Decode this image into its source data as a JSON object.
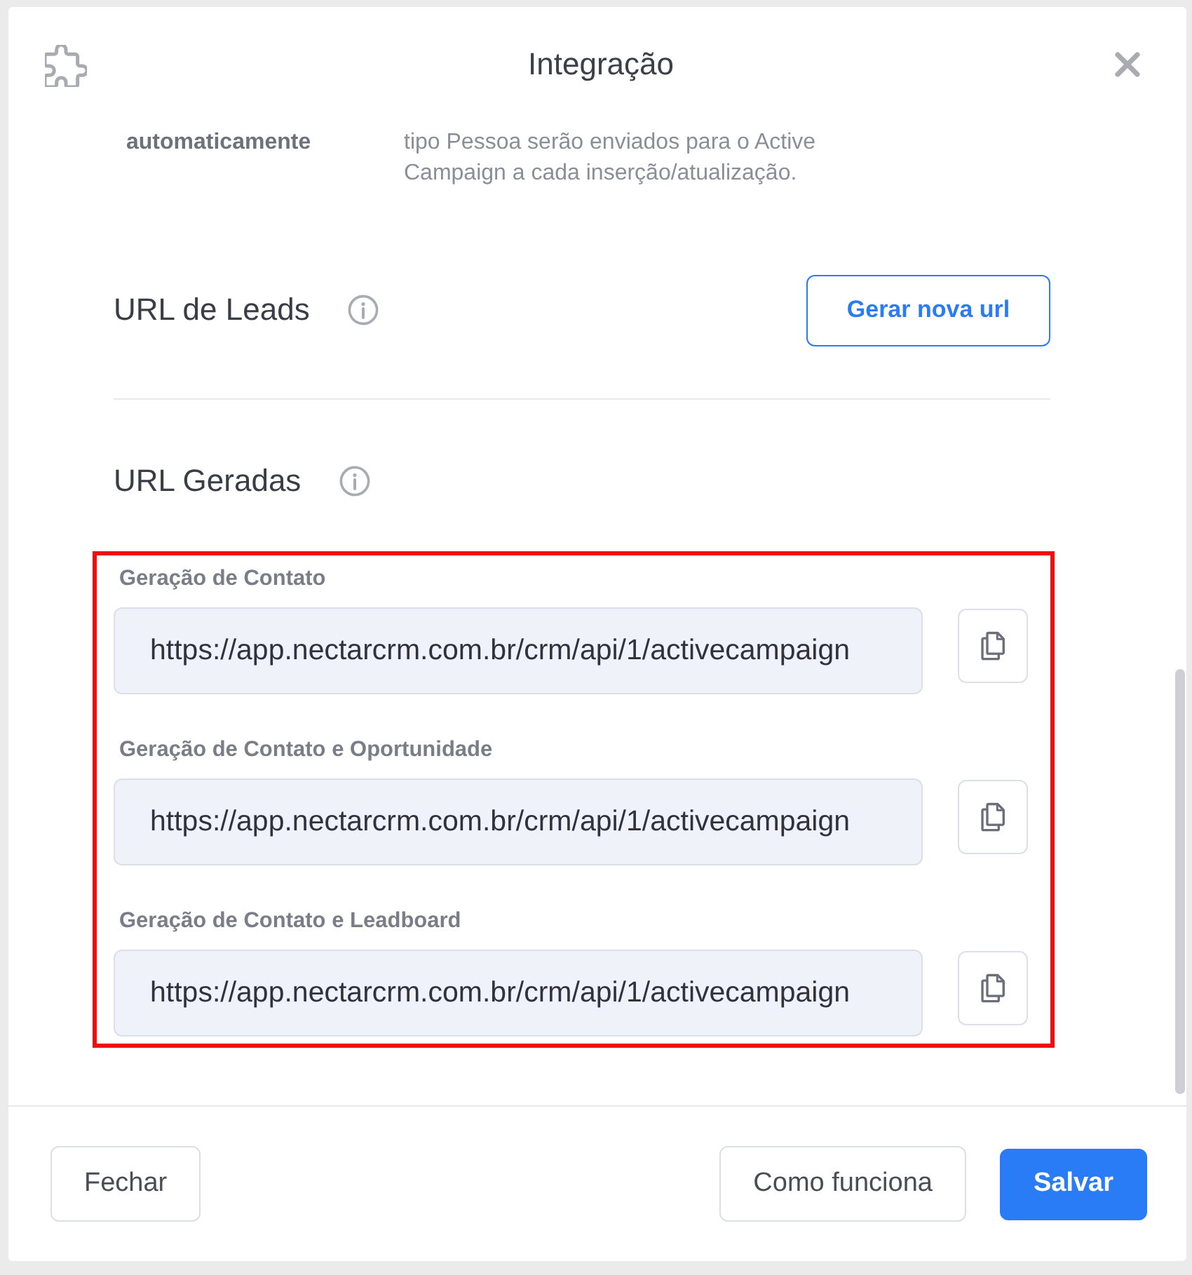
{
  "dialog": {
    "title": "Integração"
  },
  "setting_row": {
    "label": "automaticamente",
    "description": "tipo Pessoa serão enviados para o Active\nCampaign a cada inserção/atualização."
  },
  "leads_url": {
    "title": "URL de Leads",
    "button": "Gerar nova url"
  },
  "generated_urls": {
    "title": "URL Geradas",
    "highlighted": true,
    "items": [
      {
        "label": "Geração de Contato",
        "value": "https://app.nectarcrm.com.br/crm/api/1/activecampaign"
      },
      {
        "label": "Geração de Contato e Oportunidade",
        "value": "https://app.nectarcrm.com.br/crm/api/1/activecampaign"
      },
      {
        "label": "Geração de Contato e Leadboard",
        "value": "https://app.nectarcrm.com.br/crm/api/1/activecampaign"
      }
    ]
  },
  "footer": {
    "buttons": [
      {
        "label": "Fechar",
        "kind": "secondary"
      },
      {
        "label": "Como funciona",
        "kind": "secondary"
      },
      {
        "label": "Salvar",
        "kind": "primary"
      }
    ]
  }
}
